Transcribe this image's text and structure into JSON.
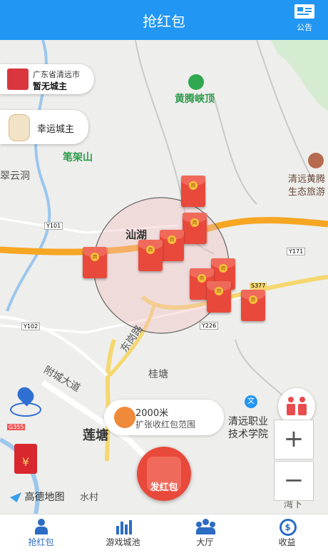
{
  "header": {
    "title": "抢红包",
    "notice_label": "公告"
  },
  "city_card": {
    "city": "广东省清远市",
    "owner": "暂无城主"
  },
  "lucky_card": {
    "label": "幸运城主"
  },
  "map": {
    "places": {
      "huangteng_peak": "黄腾峡顶",
      "bijia_mountain": "笔架山",
      "cuiyun_cave": "翠云洞",
      "qingyuan_eco_1": "清远黄腾",
      "qingyuan_eco_2": "生态旅游",
      "shanhu": "汕湖",
      "guitang": "桂塘",
      "college_1": "清远职业",
      "college_2": "技术学院",
      "lianzhou": "莲塘",
      "wanxia": "湾下",
      "shuicun": "水村",
      "donggang_road": "东岗路",
      "fucheng_avenue": "附城大道"
    },
    "roads": {
      "y101": "Y101",
      "y171": "Y171",
      "s377": "S377",
      "y102": "Y102",
      "y226": "Y226",
      "g355": "G355"
    },
    "provider": "高德地图"
  },
  "range": {
    "distance": "2000米",
    "hint": "扩张收红包范围"
  },
  "send_button": "发红包",
  "zoom": {
    "in": "+",
    "out": "−"
  },
  "tabs": [
    {
      "label": "抢红包",
      "icon": "user-icon"
    },
    {
      "label": "游戏城池",
      "icon": "bar-chart-icon"
    },
    {
      "label": "大厅",
      "icon": "group-icon"
    },
    {
      "label": "收益",
      "icon": "money-cycle-icon"
    }
  ],
  "colors": {
    "primary": "#2196f3",
    "packet": "#e8493b",
    "road": "#f6a623"
  }
}
